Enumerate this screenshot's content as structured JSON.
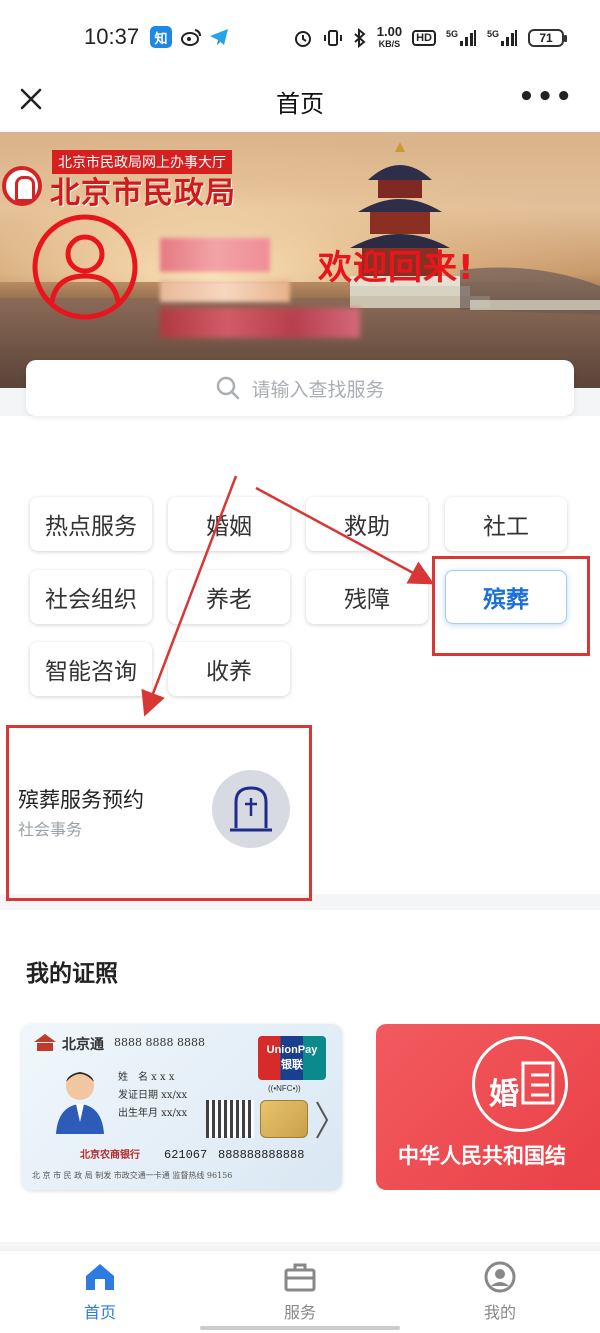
{
  "status_bar": {
    "time": "10:37",
    "app_icons": [
      "知",
      "weibo",
      "telegram"
    ],
    "net_speed_value": "1.00",
    "net_speed_unit": "KB/S",
    "hd": "HD",
    "signal1": "5G",
    "signal2": "5G",
    "battery": "71"
  },
  "nav": {
    "title": "首页"
  },
  "banner": {
    "subtitle": "北京市民政局网上办事大厅",
    "bureau_name": "北京市民政局",
    "welcome": "欢迎回来!"
  },
  "search": {
    "placeholder": "请输入查找服务"
  },
  "categories": [
    {
      "label": "热点服务",
      "active": false
    },
    {
      "label": "婚姻",
      "active": false
    },
    {
      "label": "救助",
      "active": false
    },
    {
      "label": "社工",
      "active": false
    },
    {
      "label": "社会组织",
      "active": false
    },
    {
      "label": "养老",
      "active": false
    },
    {
      "label": "残障",
      "active": false
    },
    {
      "label": "殡葬",
      "active": true
    },
    {
      "label": "智能咨询",
      "active": false
    },
    {
      "label": "收养",
      "active": false
    }
  ],
  "service_card": {
    "title": "殡葬服务预约",
    "subtitle": "社会事务",
    "icon": "tombstone-icon"
  },
  "certificates": {
    "section_title": "我的证照",
    "card1": {
      "brand": "北京通",
      "number": "8888 8888 8888",
      "fields": [
        "姓　名  x x x",
        "发证日期  xx/xx",
        "出生年月  xx/xx"
      ],
      "unionpay_en": "UnionPay",
      "unionpay_cn": "银联",
      "nfc": "((•NFC•))",
      "bank": "北京农商银行",
      "account_prefix": "621067",
      "account": "888888888888",
      "footer": "北 京 市 民 政 局 制发    市政交通一卡通    监督热线 96156"
    },
    "card2": {
      "logo_char": "婚",
      "text": "中华人民共和国结"
    }
  },
  "tabbar": [
    {
      "label": "首页",
      "icon": "home-icon",
      "active": true
    },
    {
      "label": "服务",
      "icon": "briefcase-icon",
      "active": false
    },
    {
      "label": "我的",
      "icon": "user-circle-icon",
      "active": false
    }
  ],
  "colors": {
    "accent": "#2d7be0",
    "annotation_red": "#d93636",
    "welcome_red": "#e8161c"
  }
}
